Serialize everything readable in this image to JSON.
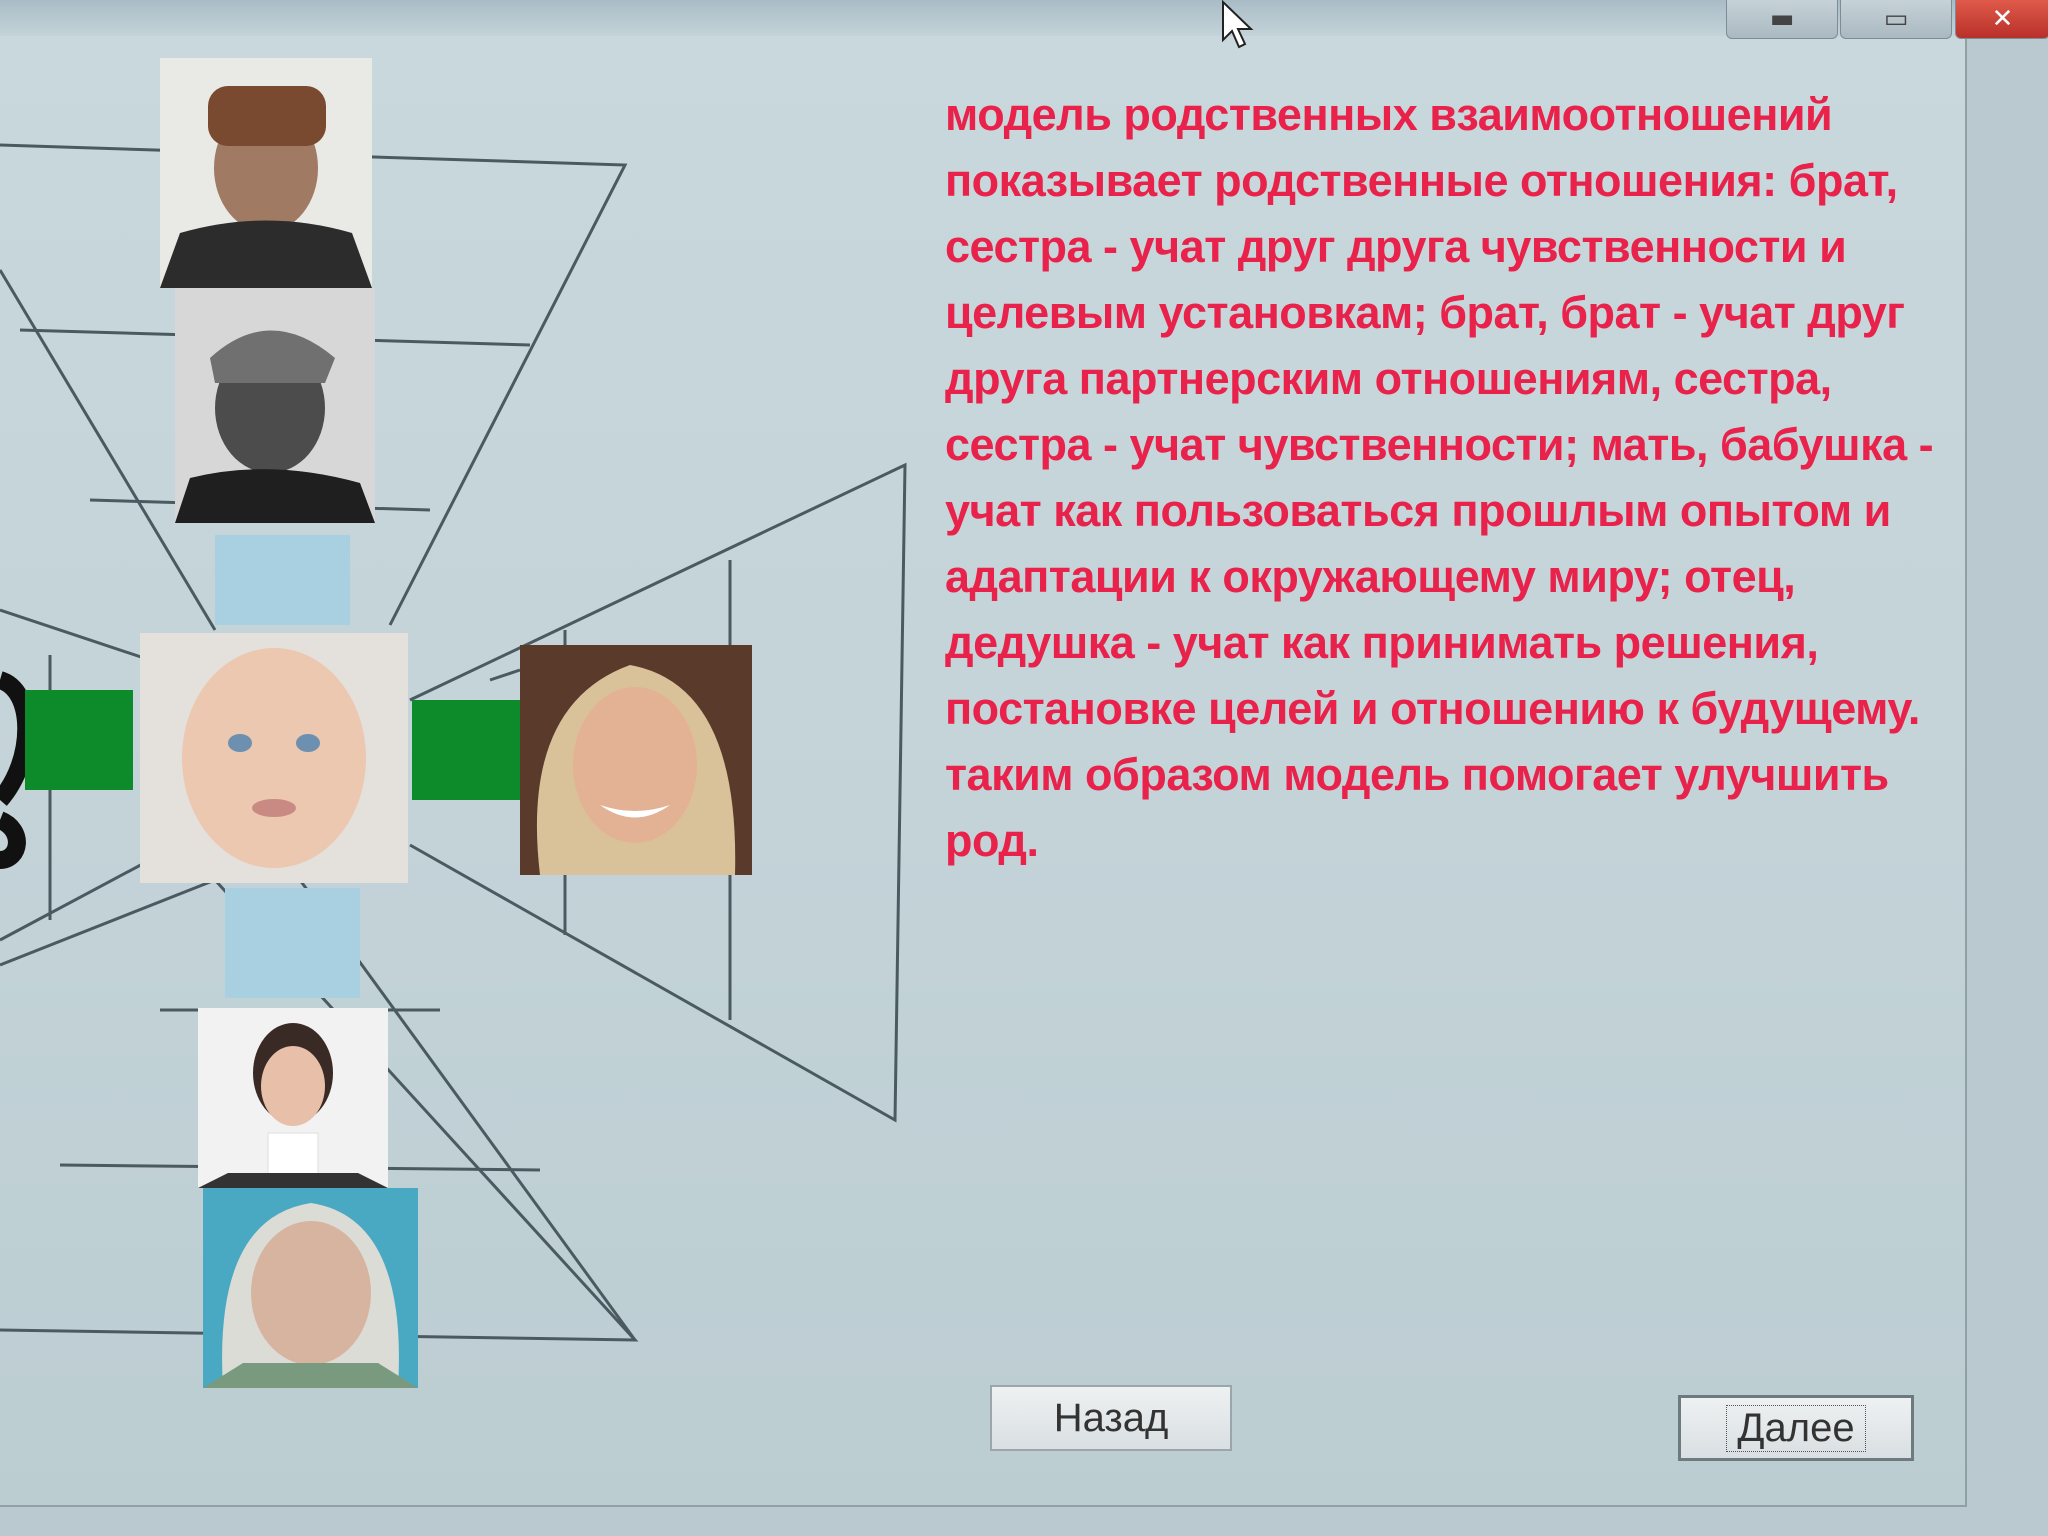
{
  "window": {
    "titlebar_buttons": [
      "minimize-icon",
      "maximize-icon",
      "close-icon"
    ]
  },
  "diagram": {
    "photos": [
      "grandfather-photo",
      "father-photo",
      "child-photo",
      "woman-photo",
      "mother-photo",
      "grandmother-photo"
    ],
    "colors": {
      "blue_block": "#a9d0e0",
      "green_block": "#0d8a2a",
      "lines": "#4a5a60"
    }
  },
  "main": {
    "description": "модель родственных взаимоотношений показывает родственные отношения: брат, сестра - учат друг друга чувственности и целевым установкам; брат, брат - учат друг друга партнерским отношениям, сестра, сестра - учат чувственности; мать, бабушка - учат как пользоваться прошлым опытом и адаптации к окружающему миру; отец, дедушка - учат как принимать решения, постановке целей и отношению к будущему. таким образом модель помогает улучшить род.",
    "text_color": "#e8224a"
  },
  "buttons": {
    "back_label": "Назад",
    "next_label": "Далее"
  }
}
